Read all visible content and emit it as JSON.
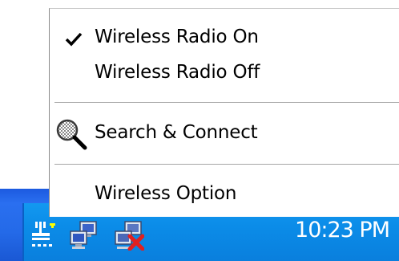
{
  "menu": {
    "items": [
      {
        "label": "Wireless Radio On",
        "checked": true
      },
      {
        "label": "Wireless Radio Off",
        "checked": false
      },
      {
        "label": "Search & Connect",
        "icon": "search-icon"
      },
      {
        "label": "Wireless Option"
      }
    ]
  },
  "taskbar": {
    "clock": "10:23 PM",
    "tray_icons": [
      "wireless-network-icon",
      "network-connected-icon",
      "network-disconnected-icon"
    ]
  },
  "colors": {
    "taskbar_blue": "#245edb",
    "tray_blue": "#0f8de8",
    "menu_bg": "#ffffff",
    "separator": "#a6a6a6",
    "error_red": "#e02020"
  }
}
